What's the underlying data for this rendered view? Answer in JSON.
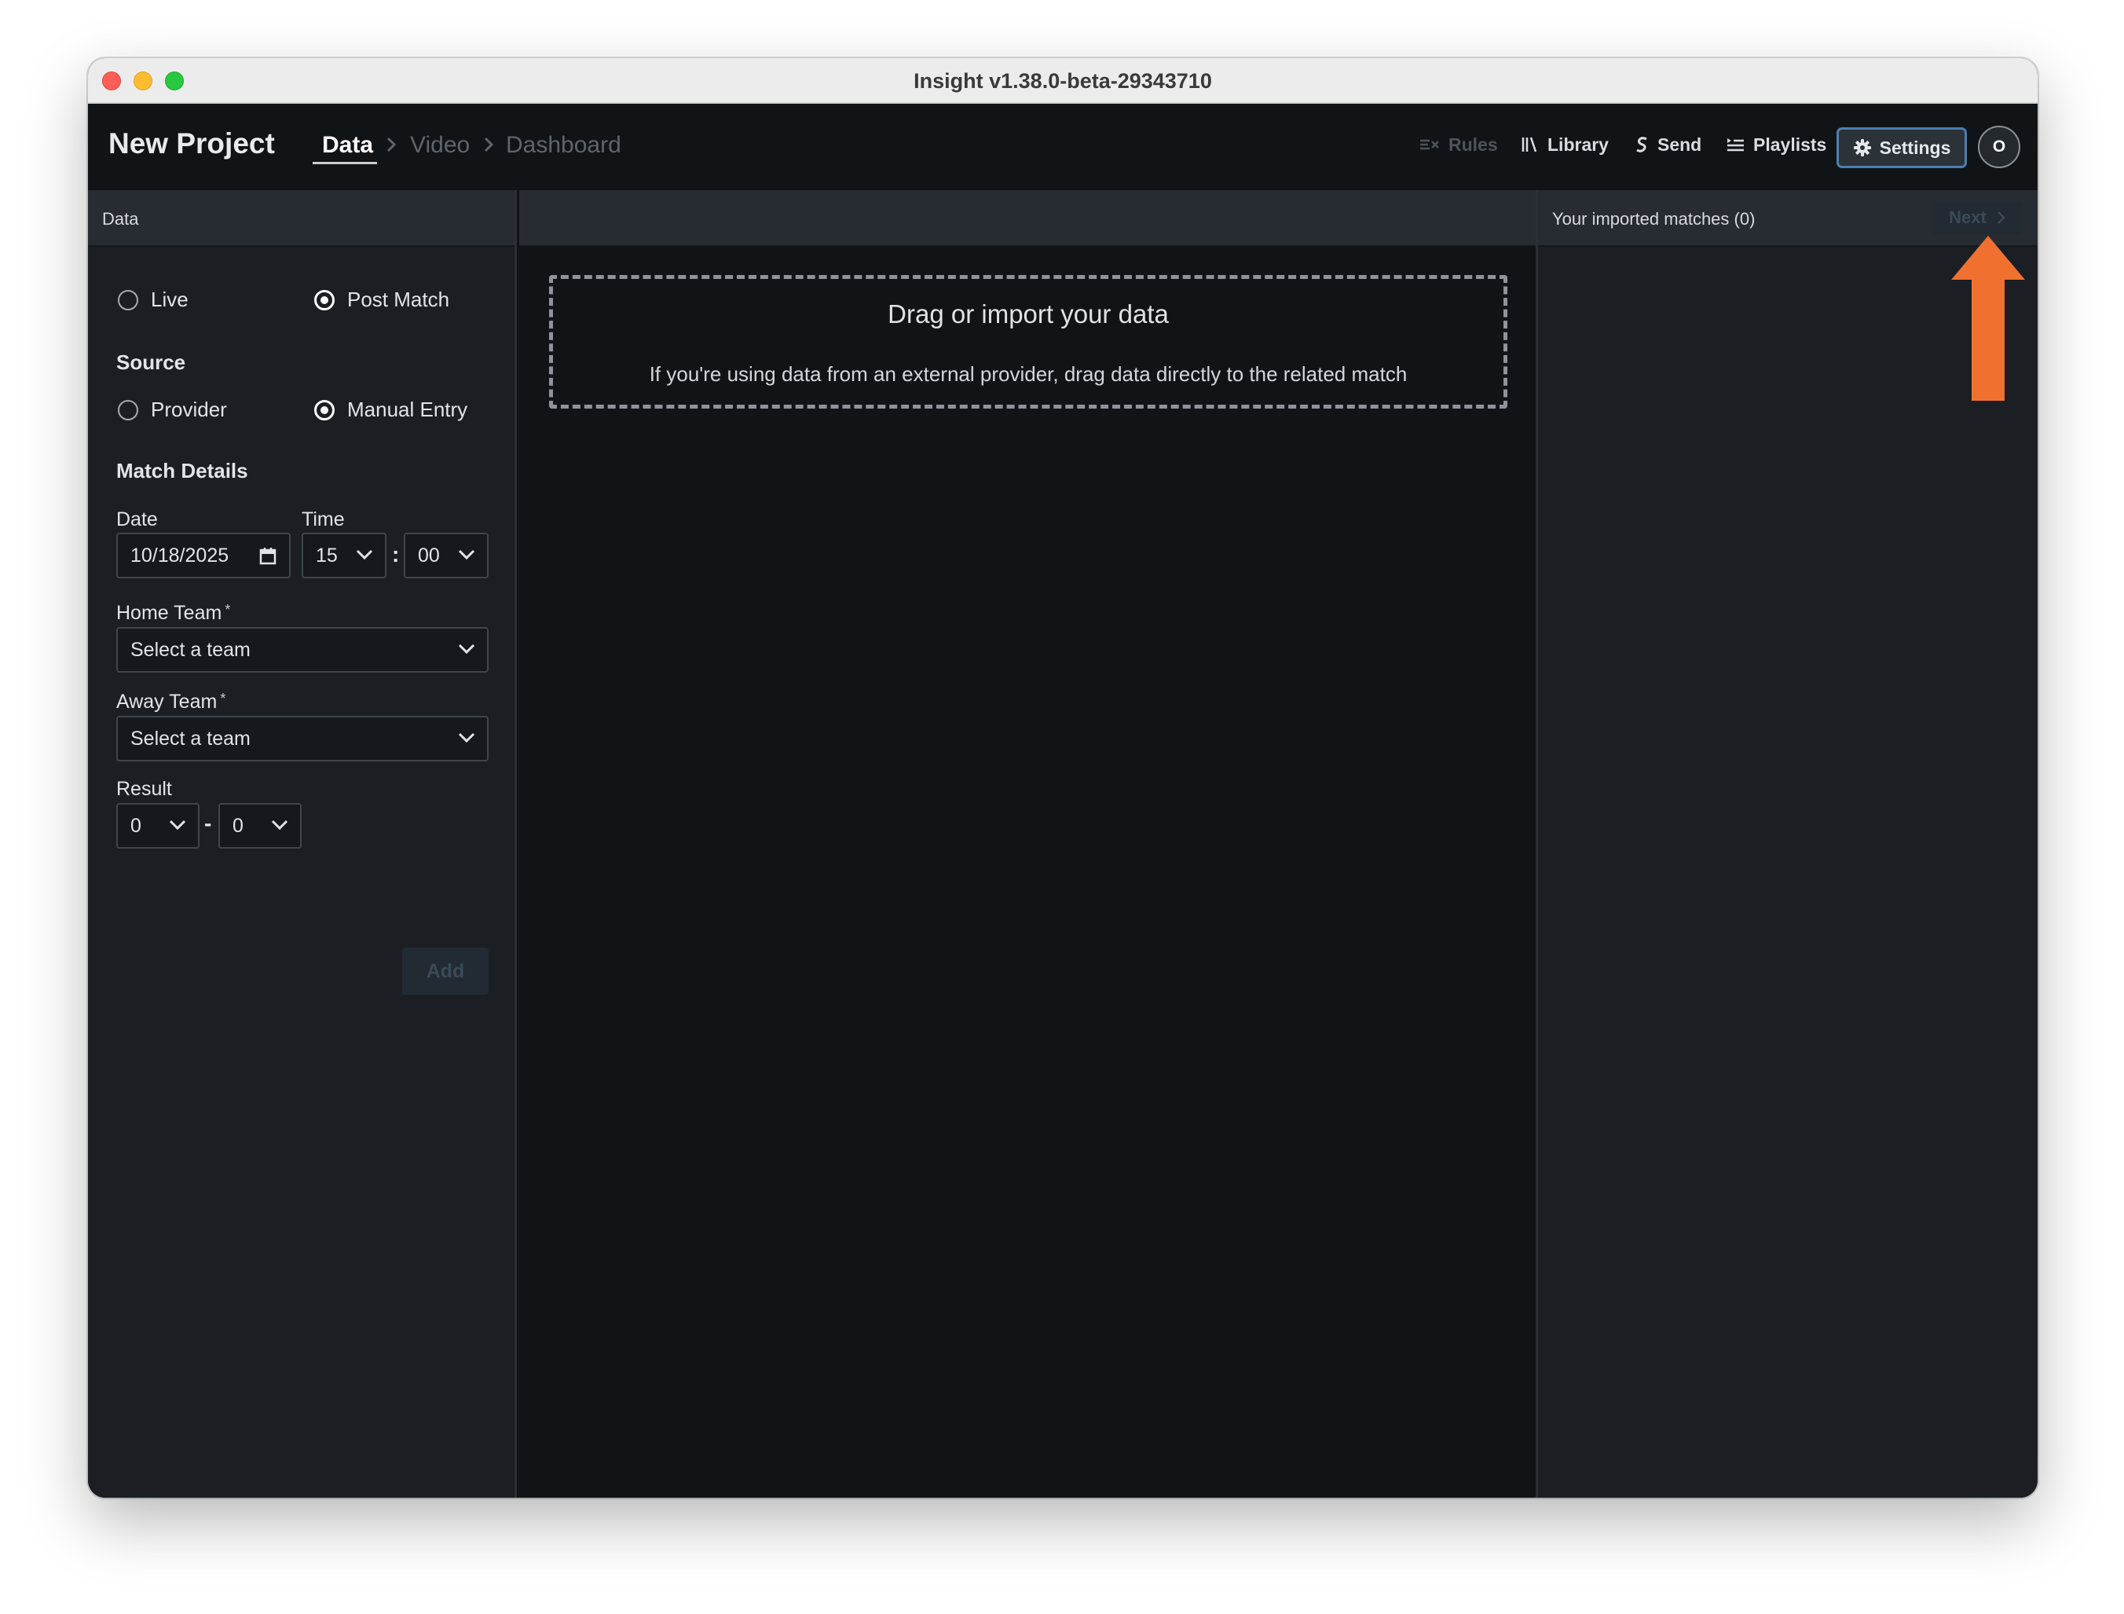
{
  "window": {
    "title": "Insight v1.38.0-beta-29343710"
  },
  "header": {
    "project_name": "New Project",
    "breadcrumbs": [
      "Data",
      "Video",
      "Dashboard"
    ],
    "nav": {
      "rules": "Rules",
      "library": "Library",
      "send": "Send",
      "playlists": "Playlists",
      "settings": "Settings"
    },
    "avatar_initial": "O"
  },
  "left_panel": {
    "header": "Data",
    "mode": {
      "live": "Live",
      "post_match": "Post Match",
      "selected": "Post Match"
    },
    "source": {
      "title": "Source",
      "provider": "Provider",
      "manual": "Manual Entry",
      "selected": "Manual Entry"
    },
    "match_details": {
      "title": "Match Details",
      "date_label": "Date",
      "date_value": "10/18/2025",
      "time_label": "Time",
      "hour": "15",
      "minute": "00",
      "home_team_label": "Home Team",
      "home_team_placeholder": "Select a team",
      "away_team_label": "Away Team",
      "away_team_placeholder": "Select a team",
      "required_mark": "*",
      "result_label": "Result",
      "home_score": "0",
      "away_score": "0",
      "score_separator": "-",
      "time_separator": ":",
      "add_button": "Add"
    }
  },
  "main": {
    "drop_title": "Drag or import your data",
    "drop_subtitle": "If you're using data from an external provider, drag data directly to the related match"
  },
  "right_panel": {
    "title": "Your imported matches (0)",
    "next_button": "Next"
  },
  "colors": {
    "accent_arrow": "#f07030",
    "settings_border": "#4b7fb3",
    "background": "#111417",
    "panel": "#1b1f24"
  },
  "icons": [
    "rules-icon",
    "library-icon",
    "send-icon",
    "playlists-icon",
    "gear-icon",
    "calendar-icon",
    "chevron-down-icon",
    "chevron-right-icon",
    "arrow-up-icon"
  ]
}
